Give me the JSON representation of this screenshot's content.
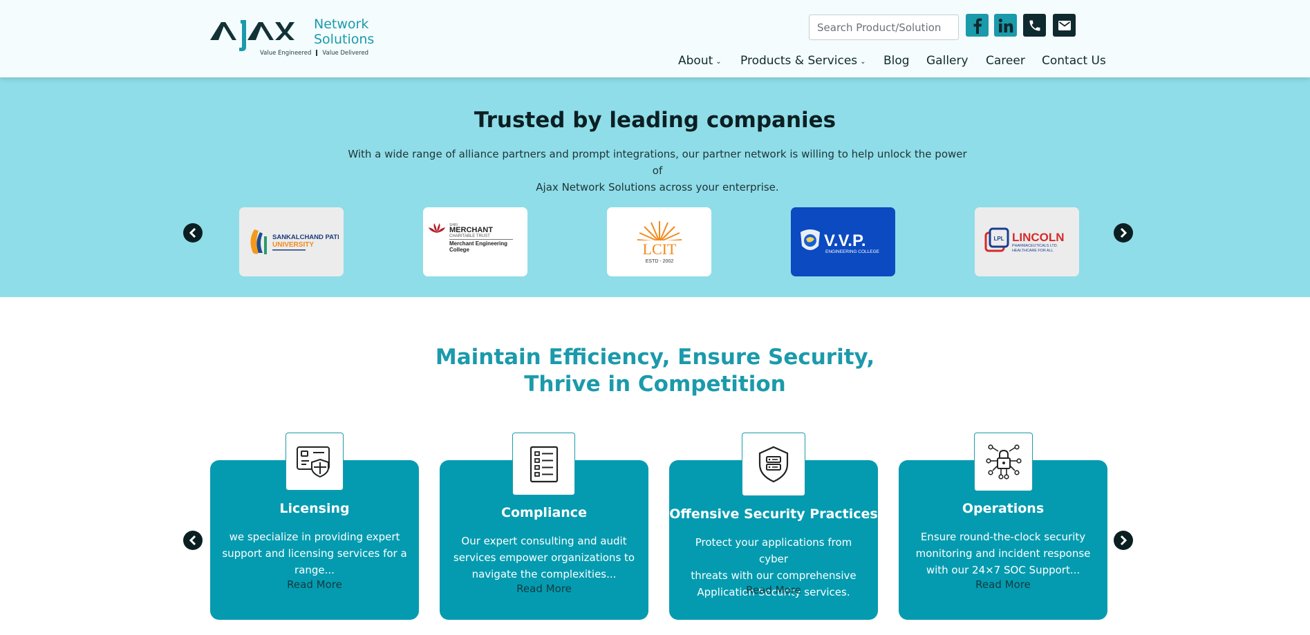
{
  "brand": {
    "name_line1": "Network",
    "name_line2": "Solutions",
    "tagline_left": "Value Engineered",
    "tagline_right": "Value Delivered"
  },
  "header": {
    "search_placeholder": "Search Product/Solution",
    "social": [
      {
        "icon": "facebook-icon"
      },
      {
        "icon": "linkedin-icon"
      },
      {
        "icon": "phone-icon"
      },
      {
        "icon": "mail-icon"
      }
    ],
    "nav": [
      {
        "label": "About",
        "has_dropdown": true
      },
      {
        "label": "Products & Services",
        "has_dropdown": true
      },
      {
        "label": "Blog",
        "has_dropdown": false
      },
      {
        "label": "Gallery",
        "has_dropdown": false
      },
      {
        "label": "Career",
        "has_dropdown": false
      },
      {
        "label": "Contact Us",
        "has_dropdown": false
      }
    ]
  },
  "trusted": {
    "title": "Trusted by leading companies",
    "description_line1": "With a wide range of alliance partners and prompt integrations, our partner network is willing to help unlock the power of",
    "description_line2": "Ajax Network Solutions across your enterprise.",
    "partners": [
      {
        "line1": "SANKALCHAND PATEL",
        "line2": "UNIVERSITY"
      },
      {
        "pre": "SHRI",
        "line1": "MERCHANT",
        "line2": "CHARITABLE TRUST",
        "line3": "Merchant Engineering",
        "line4": "College"
      },
      {
        "line1": "LCIT",
        "line2": "ESTD - 2002"
      },
      {
        "line1": "V.V.P.",
        "line2": "ENGINEERING COLLEGE"
      },
      {
        "badge": "LPL",
        "line1": "LINCOLN",
        "line2": "PHARMACEUTICALS LTD.",
        "line3": "HEALTHCARE FOR ALL"
      }
    ]
  },
  "services": {
    "title_line1": "Maintain Efficiency, Ensure Security,",
    "title_line2": "Thrive in Competition",
    "cards": [
      {
        "icon": "card-shield-icon",
        "title": "Licensing",
        "desc": [
          "we specialize in providing expert",
          "support and licensing services for a",
          "range..."
        ],
        "more": "Read More"
      },
      {
        "icon": "checklist-icon",
        "title": "Compliance",
        "desc": [
          "Our expert consulting and audit",
          "services empower organizations to",
          "navigate the complexities..."
        ],
        "more": "Read More"
      },
      {
        "icon": "shield-server-icon",
        "title": "Offensive Security Practices",
        "desc": [
          "Protect your applications from cyber",
          "threats with our comprehensive",
          "Application Security services."
        ],
        "more": "Read More"
      },
      {
        "icon": "network-lock-icon",
        "title": "Operations",
        "desc": [
          "Ensure round-the-clock security",
          "monitoring and incident response",
          "with our 24×7 SOC Support..."
        ],
        "more": "Read More"
      }
    ]
  },
  "colors": {
    "accent": "#1b9aab",
    "band": "#8fdde8",
    "card": "#049bb0",
    "dark": "#0b1f22"
  }
}
